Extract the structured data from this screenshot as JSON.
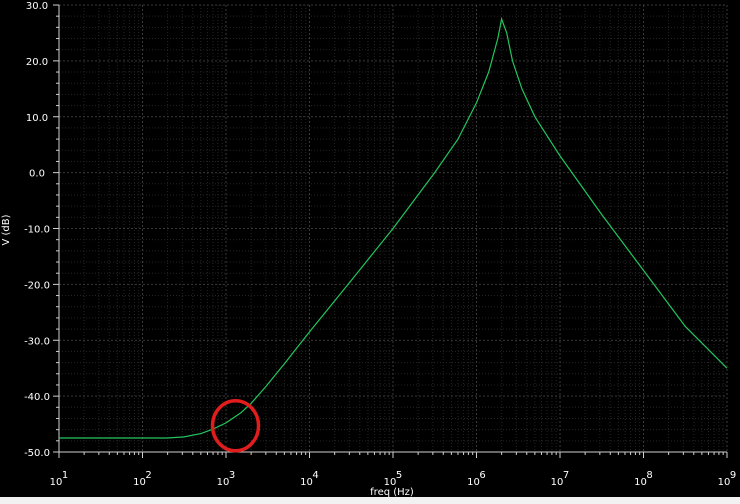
{
  "chart_data": {
    "type": "line",
    "xlabel": "freq (Hz)",
    "ylabel": "V (dB)",
    "xscale": "log",
    "xlim": [
      10,
      1000000000
    ],
    "ylim": [
      -50,
      30
    ],
    "grid": true,
    "x_ticks": [
      {
        "value": 10,
        "base": "10",
        "exp": "1"
      },
      {
        "value": 100,
        "base": "10",
        "exp": "2"
      },
      {
        "value": 1000,
        "base": "10",
        "exp": "3"
      },
      {
        "value": 10000,
        "base": "10",
        "exp": "4"
      },
      {
        "value": 100000,
        "base": "10",
        "exp": "5"
      },
      {
        "value": 1000000,
        "base": "10",
        "exp": "6"
      },
      {
        "value": 10000000,
        "base": "10",
        "exp": "7"
      },
      {
        "value": 100000000,
        "base": "10",
        "exp": "8"
      },
      {
        "value": 1000000000,
        "base": "10",
        "exp": "9"
      }
    ],
    "y_ticks": [
      {
        "value": 30,
        "label": "30.0"
      },
      {
        "value": 20,
        "label": "20.0"
      },
      {
        "value": 10,
        "label": "10.0"
      },
      {
        "value": 0,
        "label": "0.0"
      },
      {
        "value": -10,
        "label": "-10.0"
      },
      {
        "value": -20,
        "label": "-20.0"
      },
      {
        "value": -30,
        "label": "-30.0"
      },
      {
        "value": -40,
        "label": "-40.0"
      },
      {
        "value": -50,
        "label": "-50.0"
      }
    ],
    "series": [
      {
        "color": "#22c55e",
        "points": [
          [
            10,
            -47.5
          ],
          [
            100,
            -47.5
          ],
          [
            200,
            -47.5
          ],
          [
            316,
            -47.3
          ],
          [
            500,
            -46.7
          ],
          [
            700,
            -45.9
          ],
          [
            1000,
            -44.8
          ],
          [
            1500,
            -43.0
          ],
          [
            2000,
            -41.3
          ],
          [
            3000,
            -38.3
          ],
          [
            5000,
            -34.2
          ],
          [
            10000,
            -28.5
          ],
          [
            31600,
            -19.3
          ],
          [
            100000,
            -10.0
          ],
          [
            316000,
            0.0
          ],
          [
            600000,
            6.0
          ],
          [
            1000000,
            12.5
          ],
          [
            1400000,
            18.0
          ],
          [
            1800000,
            24.0
          ],
          [
            2000000,
            27.5
          ],
          [
            2300000,
            25.0
          ],
          [
            2700000,
            20.0
          ],
          [
            3500000,
            15.0
          ],
          [
            5000000,
            10.0
          ],
          [
            10000000,
            3.0
          ],
          [
            31600000,
            -7.5
          ],
          [
            100000000,
            -17.5
          ],
          [
            316000000,
            -27.5
          ],
          [
            1000000000,
            -35.0
          ]
        ]
      }
    ],
    "annotations": [
      {
        "type": "circle",
        "color": "#e11d1d",
        "x": 1300,
        "y": -45.3
      }
    ],
    "colors": {
      "background": "#000000",
      "grid_major": "#3a3a3a",
      "grid_minor": "#242424",
      "axis": "#d0d0d0",
      "text": "#ffffff"
    }
  }
}
